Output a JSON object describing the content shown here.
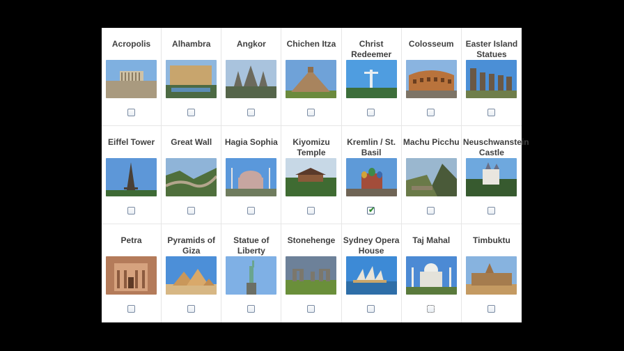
{
  "wonders": [
    {
      "id": "acropolis",
      "label": "Acropolis",
      "checked": false
    },
    {
      "id": "alhambra",
      "label": "Alhambra",
      "checked": false
    },
    {
      "id": "angkor",
      "label": "Angkor",
      "checked": false
    },
    {
      "id": "chichen-itza",
      "label": "Chichen Itza",
      "checked": false
    },
    {
      "id": "christ-redeemer",
      "label": "Christ Redeemer",
      "checked": false
    },
    {
      "id": "colosseum",
      "label": "Colosseum",
      "checked": false
    },
    {
      "id": "easter-island",
      "label": "Easter Island Statues",
      "checked": false
    },
    {
      "id": "eiffel-tower",
      "label": "Eiffel Tower",
      "checked": false
    },
    {
      "id": "great-wall",
      "label": "Great Wall",
      "checked": false
    },
    {
      "id": "hagia-sophia",
      "label": "Hagia Sophia",
      "checked": false
    },
    {
      "id": "kiyomizu",
      "label": "Kiyomizu Temple",
      "checked": false
    },
    {
      "id": "kremlin",
      "label": "Kremlin / St. Basil",
      "checked": true
    },
    {
      "id": "machu-picchu",
      "label": "Machu Picchu",
      "checked": false
    },
    {
      "id": "neuschwanstein",
      "label": "Neuschwanstein Castle",
      "checked": false
    },
    {
      "id": "petra",
      "label": "Petra",
      "checked": false
    },
    {
      "id": "pyramids",
      "label": "Pyramids of Giza",
      "checked": false
    },
    {
      "id": "statue-of-liberty",
      "label": "Statue of Liberty",
      "checked": false
    },
    {
      "id": "stonehenge",
      "label": "Stonehenge",
      "checked": false
    },
    {
      "id": "sydney-opera",
      "label": "Sydney Opera House",
      "checked": false
    },
    {
      "id": "taj-mahal",
      "label": "Taj Mahal",
      "checked": false,
      "focused": true
    },
    {
      "id": "timbuktu",
      "label": "Timbuktu",
      "checked": false
    }
  ],
  "colors": {
    "check": "#2f8a2f",
    "label": "#3f3f3f",
    "border": "#e6e6e6"
  }
}
